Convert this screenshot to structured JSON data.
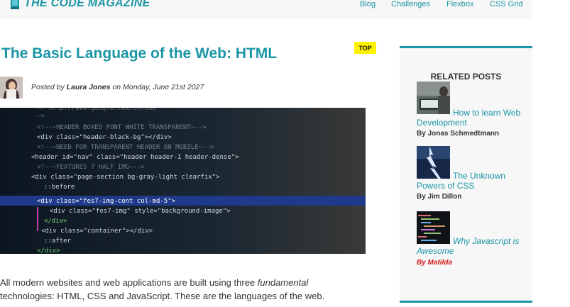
{
  "header": {
    "site_title": "THE CODE MAGAZINE",
    "nav": [
      "Blog",
      "Challenges",
      "Flexbox",
      "CSS Grid"
    ]
  },
  "article": {
    "title": "The Basic Language of the Web: HTML",
    "badge": "TOP",
    "byline_prefix": "Posted by ",
    "author": "Laura Jones",
    "byline_suffix": " on Monday, June 21st 2027",
    "intro_part1": "All modern websites and web applications are built using three ",
    "intro_em": "fundamental",
    "intro_part2": " technologies: HTML, CSS and JavaScript. These are the languages of the web.",
    "hero_code": [
      "<!--~HEADER BOXED FONT WHITE TRANSPARENT~-->",
      "<div class=\"header-black-bg\"></div>",
      "<!--~NEED FOR TRANSPARENT HEADER ON MOBILE~-->",
      "<header id=\"nav\" class=\"header header-1 header-dense\">",
      "<!--~FEATURES 7 HALF IMG~-->",
      "<div class=\"page-section bg-gray-light clearfix\">",
      "::before",
      "<div class=\"fes7-img-cont col-md-5\">",
      "<div class=\"fes7-img\" style=\"background-image\">",
      "</div>",
      "<div class=\"container\"></div>",
      "::after",
      "</div>"
    ]
  },
  "sidebar": {
    "title": "RELATED POSTS",
    "posts": [
      {
        "title": "How to learn Web Development",
        "author": "By Jonas Schmedtmann"
      },
      {
        "title": "The Unknown Powers of CSS",
        "author": "By Jim Dillon"
      },
      {
        "title": "Why Javascript is Awesome",
        "author": "By Matilda"
      }
    ]
  },
  "colors": {
    "accent": "#1a95a6",
    "badge": "#fff200",
    "red_author": "#d11a1a"
  }
}
